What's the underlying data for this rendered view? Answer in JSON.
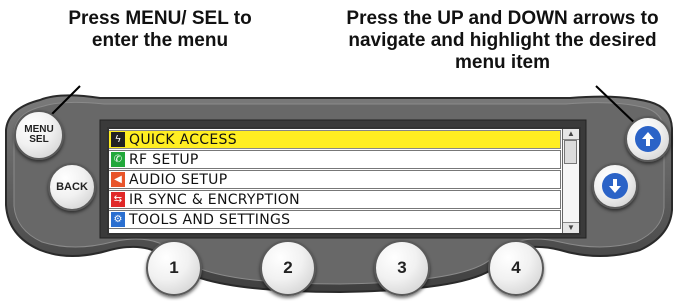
{
  "callouts": {
    "menu_sel": "Press MENU/ SEL to enter the menu",
    "arrows": "Press the UP and DOWN arrows to navigate and highlight the desired menu item"
  },
  "buttons": {
    "menu_line1": "MENU",
    "menu_line2": "SEL",
    "back": "BACK",
    "num1": "1",
    "num2": "2",
    "num3": "3",
    "num4": "4",
    "up_icon": "arrow-up-icon",
    "down_icon": "arrow-down-icon"
  },
  "menu": {
    "items": [
      {
        "label": "QUICK ACCESS",
        "icon": "lightning-icon",
        "icon_color": "#222222",
        "selected": true
      },
      {
        "label": "RF SETUP",
        "icon": "antenna-icon",
        "icon_color": "#22a83a",
        "selected": false
      },
      {
        "label": "AUDIO SETUP",
        "icon": "speaker-icon",
        "icon_color": "#e8542a",
        "selected": false
      },
      {
        "label": "IR SYNC & ENCRYPTION",
        "icon": "sync-icon",
        "icon_color": "#e02828",
        "selected": false
      },
      {
        "label": "TOOLS AND SETTINGS",
        "icon": "tools-icon",
        "icon_color": "#2a6fd0",
        "selected": false
      }
    ],
    "highlight_color": "#ffee22"
  },
  "colors": {
    "arrow_blue": "#2b63c7",
    "panel": "#5b5b5b"
  }
}
